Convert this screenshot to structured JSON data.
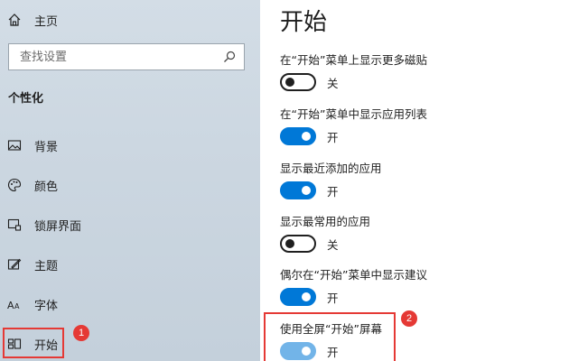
{
  "sidebar": {
    "home_label": "主页",
    "search_placeholder": "查找设置",
    "section_title": "个性化",
    "items": [
      {
        "label": "背景",
        "icon": "picture-icon"
      },
      {
        "label": "颜色",
        "icon": "palette-icon"
      },
      {
        "label": "锁屏界面",
        "icon": "lock-screen-icon"
      },
      {
        "label": "主题",
        "icon": "theme-brush-icon"
      },
      {
        "label": "字体",
        "icon": "font-icon"
      },
      {
        "label": "开始",
        "icon": "start-layout-icon",
        "active": true
      }
    ],
    "annotation_badge": "1"
  },
  "main": {
    "title": "开始",
    "settings": [
      {
        "label": "在“开始”菜单上显示更多磁贴",
        "state": "off",
        "state_label": "关"
      },
      {
        "label": "在“开始”菜单中显示应用列表",
        "state": "on",
        "state_label": "开"
      },
      {
        "label": "显示最近添加的应用",
        "state": "on",
        "state_label": "开"
      },
      {
        "label": "显示最常用的应用",
        "state": "off",
        "state_label": "关"
      },
      {
        "label": "偶尔在“开始”菜单中显示建议",
        "state": "on",
        "state_label": "开"
      },
      {
        "label": "使用全屏“开始”屏幕",
        "state": "on",
        "state_label": "开"
      }
    ],
    "annotation_badge": "2"
  },
  "colors": {
    "accent": "#0078d7",
    "annotation": "#e53935"
  }
}
